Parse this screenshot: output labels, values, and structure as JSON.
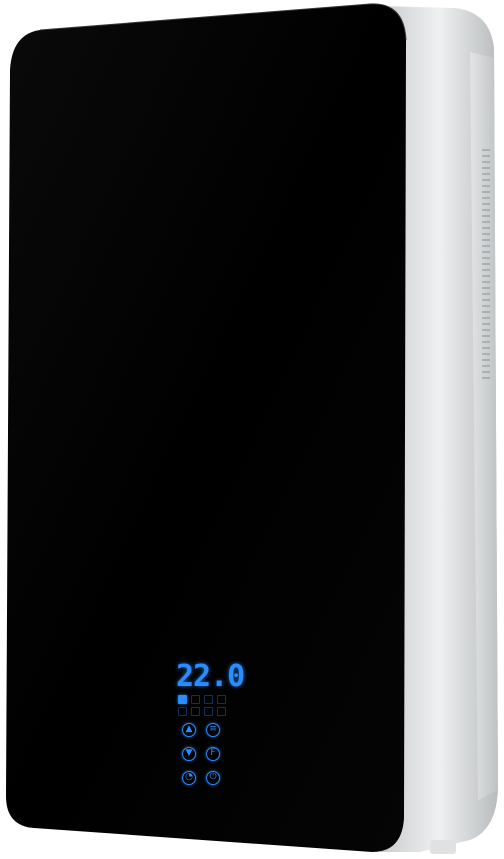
{
  "display": {
    "temperature": "22.0"
  },
  "controls": {
    "up_icon": "arrow-up-icon",
    "mode_icon": "mode-icon",
    "down_icon": "arrow-down-icon",
    "settings_icon": "settings-icon",
    "timer_icon": "timer-icon",
    "power_icon": "power-icon"
  },
  "colors": {
    "glass_panel": "#000000",
    "housing": "#d9dcde",
    "led": "#2a8cff"
  }
}
